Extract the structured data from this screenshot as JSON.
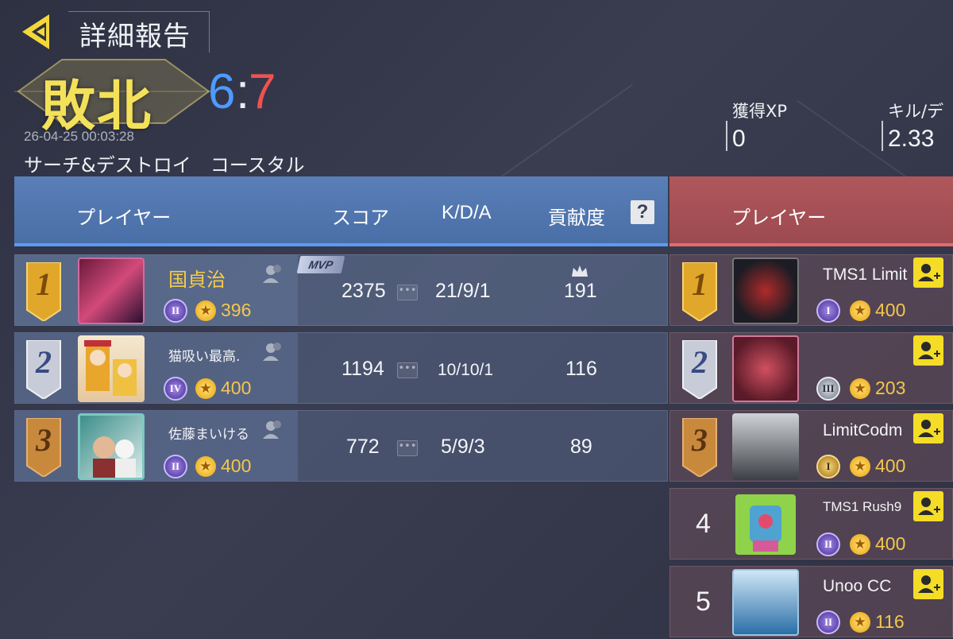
{
  "header": {
    "title": "詳細報告"
  },
  "result": {
    "label": "敗北",
    "score_left": "6",
    "score_sep": ":",
    "score_right": "7",
    "timestamp": "26-04-25 00:03:28",
    "mode": "サーチ&デストロイ　コースタル"
  },
  "stats": [
    {
      "label": "獲得XP",
      "value": "0"
    },
    {
      "label": "キル/デ",
      "value": "2.33"
    }
  ],
  "blue_team": {
    "headers": {
      "player": "プレイヤー",
      "score": "スコア",
      "kda": "K/D/A",
      "contribution": "貢献度",
      "help": "?"
    },
    "rows": [
      {
        "rank": "1",
        "name": "国貞治",
        "rank_emblem": "II",
        "points": "396",
        "score": "2375",
        "kda": "21/9/1",
        "contribution": "191",
        "mvp": "MVP"
      },
      {
        "rank": "2",
        "name": "猫吸い最高.",
        "rank_emblem": "IV",
        "points": "400",
        "score": "1194",
        "kda": "10/10/1",
        "contribution": "116"
      },
      {
        "rank": "3",
        "name": "佐藤まいける",
        "rank_emblem": "II",
        "points": "400",
        "score": "772",
        "kda": "5/9/3",
        "contribution": "89"
      }
    ]
  },
  "red_team": {
    "headers": {
      "player": "プレイヤー"
    },
    "rows": [
      {
        "rank": "1",
        "name": "TMS1 Limit",
        "rank_emblem": "I",
        "points": "400"
      },
      {
        "rank": "2",
        "name": "",
        "rank_emblem": "III",
        "points": "203"
      },
      {
        "rank": "3",
        "name": "LimitCodm",
        "rank_emblem": "I",
        "points": "400"
      },
      {
        "rank": "4",
        "name": "TMS1 Rush9",
        "rank_emblem": "II",
        "points": "400"
      },
      {
        "rank": "5",
        "name": "Unoo CC",
        "rank_emblem": "II",
        "points": "116"
      }
    ]
  },
  "colors": {
    "victory_gold": "#f4e15a",
    "blue_score": "#4d9bff",
    "red_score": "#f0524f",
    "blue_team": "#4a6ea6",
    "red_team": "#9c4a50"
  },
  "icons": {
    "back": "back-arrow-icon",
    "friend": "friend-icon",
    "add_friend": "add-friend-icon",
    "chat": "chat-icon",
    "crown": "crown-icon",
    "points": "star-coin-icon"
  }
}
